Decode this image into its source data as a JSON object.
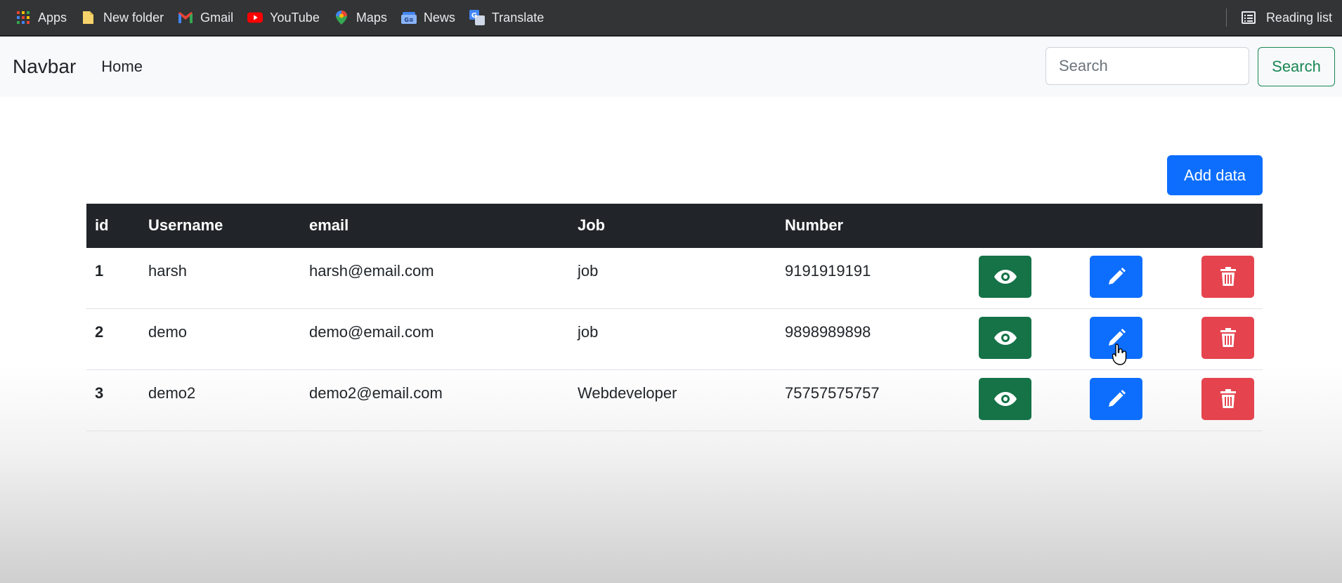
{
  "bookmarks": {
    "items": [
      {
        "label": "Apps",
        "icon": "apps-grid-icon"
      },
      {
        "label": "New folder",
        "icon": "folder-icon"
      },
      {
        "label": "Gmail",
        "icon": "gmail-icon"
      },
      {
        "label": "YouTube",
        "icon": "youtube-icon"
      },
      {
        "label": "Maps",
        "icon": "maps-pin-icon"
      },
      {
        "label": "News",
        "icon": "news-icon"
      },
      {
        "label": "Translate",
        "icon": "translate-icon"
      }
    ],
    "reading_list": "Reading list"
  },
  "navbar": {
    "brand": "Navbar",
    "home": "Home",
    "search_placeholder": "Search",
    "search_button": "Search"
  },
  "actions": {
    "add_button": "Add data"
  },
  "table": {
    "headers": [
      "id",
      "Username",
      "email",
      "Job",
      "Number"
    ],
    "rows": [
      {
        "id": "1",
        "username": "harsh",
        "email": "harsh@email.com",
        "job": "job",
        "number": "9191919191"
      },
      {
        "id": "2",
        "username": "demo",
        "email": "demo@email.com",
        "job": "job",
        "number": "9898989898"
      },
      {
        "id": "3",
        "username": "demo2",
        "email": "demo2@email.com",
        "job": "Webdeveloper",
        "number": "75757575757"
      }
    ],
    "row_actions": [
      "eye-icon",
      "pencil-icon",
      "trash-icon"
    ]
  },
  "colors": {
    "view": "#157347",
    "edit": "#0d6efd",
    "delete": "#e5434e",
    "header_bg": "#212529",
    "search_outline": "#198754"
  }
}
